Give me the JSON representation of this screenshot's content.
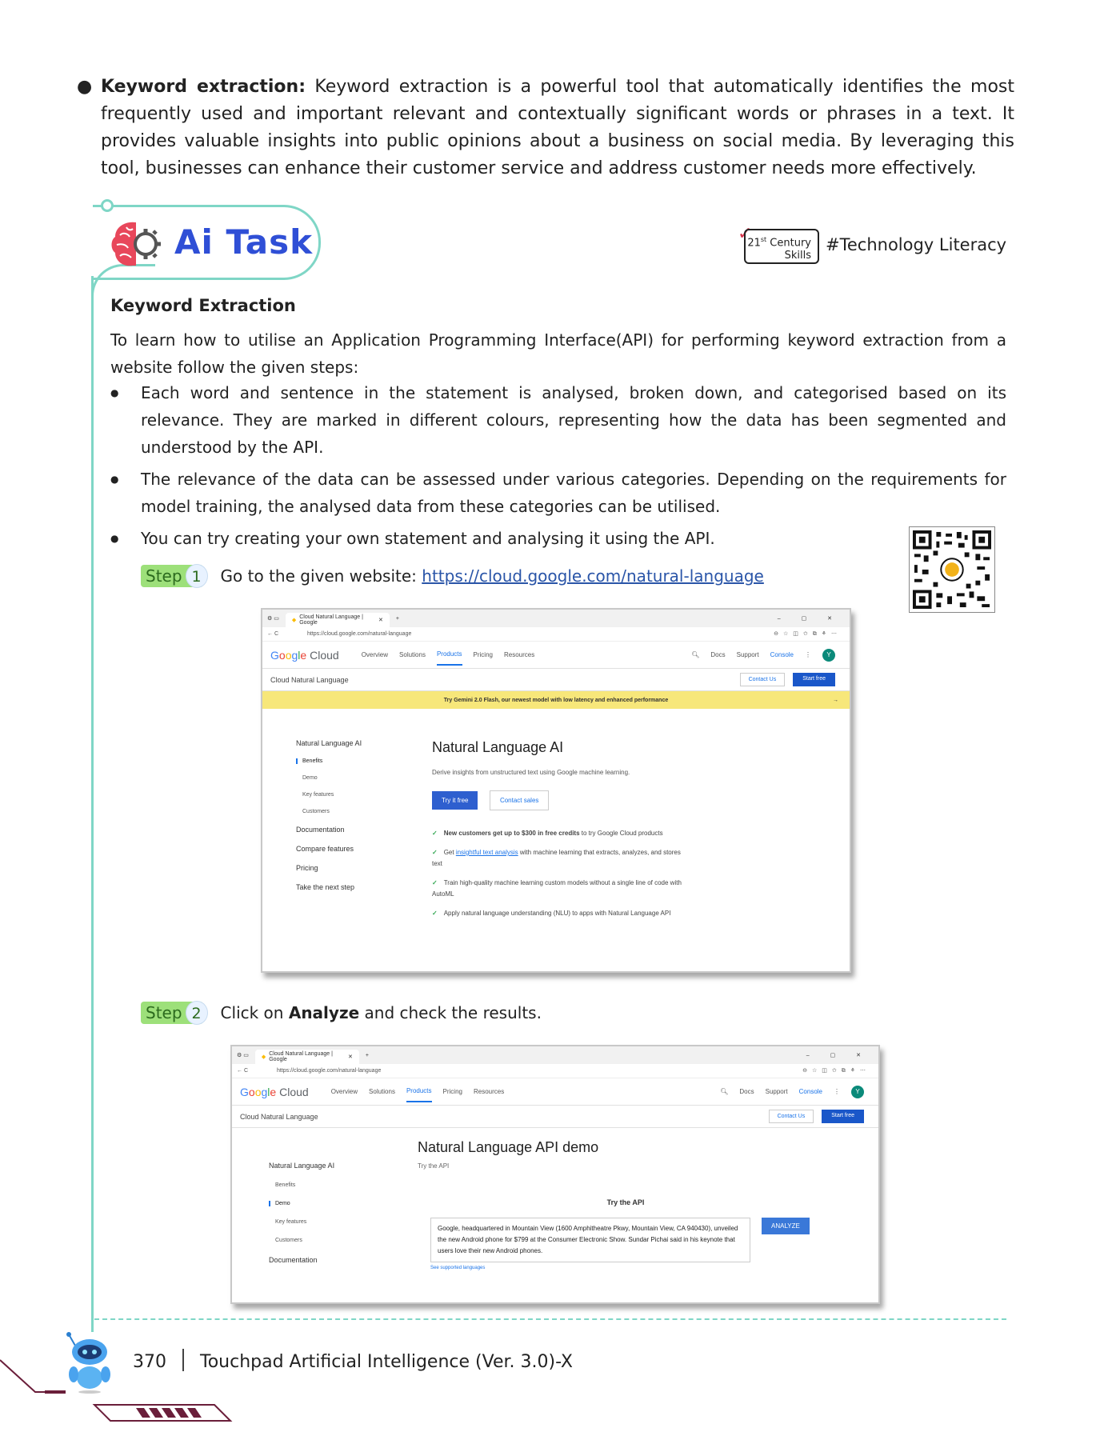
{
  "intro": {
    "term": "Keyword extraction:",
    "text": " Keyword extraction is a powerful tool that automatically identifies the most frequently used and important relevant and contextually significant words or phrases in a text. It provides valuable insights into public opinions about a business on social media. By leveraging this tool, businesses can enhance their customer service and address customer needs more effectively."
  },
  "task": {
    "title": "Ai Task",
    "badge_line1": "21",
    "badge_sup": "st",
    "badge_line1_rest": " Century",
    "badge_line2": "Skills",
    "hashtag": "#Technology Literacy"
  },
  "section": {
    "title": "Keyword Extraction",
    "body": "To learn how to utilise an Application Programming Interface(API) for performing keyword extraction from a website follow the given steps:",
    "bullets": [
      "Each word and sentence in the statement is analysed, broken down, and categorised based on its relevance. They are marked in different colours, representing how the data has been segmented and understood by the API.",
      "The relevance of the data can be assessed under various categories. Depending on the requirements for model training, the analysed data from these categories can be utilised.",
      "You can try creating your own statement and analysing it using the API."
    ]
  },
  "step1": {
    "label": "Step",
    "num": "1",
    "text": "Go to the given website: ",
    "link": "https://cloud.google.com/natural-language"
  },
  "step2": {
    "label": "Step",
    "num": "2",
    "text_a": "Click on ",
    "text_bold": "Analyze",
    "text_b": " and check the results."
  },
  "browser1": {
    "tab": "Cloud Natural Language | Google",
    "url": "https://cloud.google.com/natural-language",
    "nav": [
      "Overview",
      "Solutions",
      "Products",
      "Pricing",
      "Resources"
    ],
    "right_nav": [
      "Docs",
      "Support",
      "Console"
    ],
    "avatar": "Y",
    "subbar_title": "Cloud Natural Language",
    "contact": "Contact Us",
    "start": "Start free",
    "banner": "Try Gemini 2.0 Flash, our newest model with low latency and enhanced performance",
    "side_title": "Natural Language AI",
    "side_sub": [
      "Benefits",
      "Demo",
      "Key features",
      "Customers"
    ],
    "side_links": [
      "Documentation",
      "Compare features",
      "Pricing",
      "Take the next step"
    ],
    "heading": "Natural Language AI",
    "desc": "Derive insights from unstructured text using Google machine learning.",
    "btn_try": "Try it free",
    "btn_contact": "Contact sales",
    "checks": [
      {
        "bold": "New customers get up to $300 in free credits",
        "rest": " to try Google Cloud products"
      },
      {
        "bold": "",
        "pre": "Get ",
        "link": "insightful text analysis",
        "rest": " with machine learning that extracts, analyzes, and stores text"
      },
      {
        "bold": "",
        "rest": "Train high-quality machine learning custom models without a single line of code with AutoML"
      },
      {
        "bold": "",
        "rest": "Apply natural language understanding (NLU) to apps with Natural Language API"
      }
    ]
  },
  "browser2": {
    "tab": "Cloud Natural Language | Google",
    "url": "https://cloud.google.com/natural-language",
    "subbar_title": "Cloud Natural Language",
    "side_title": "Natural Language AI",
    "side_sub": [
      "Benefits",
      "Demo",
      "Key features",
      "Customers"
    ],
    "side_link": "Documentation",
    "heading": "Natural Language API demo",
    "sub": "Try the API",
    "try_api": "Try the API",
    "sample": "Google, headquartered in Mountain View (1600 Amphitheatre Pkwy, Mountain View, CA 940430), unveiled the new Android phone for $799 at the Consumer Electronic Show. Sundar Pichai said in his keynote that users love their new Android phones.",
    "analyze": "ANALYZE",
    "see_langs": "See supported languages"
  },
  "footer": {
    "page": "370",
    "book": "Touchpad Artificial Intelligence (Ver. 3.0)-X"
  },
  "colors": {
    "accent": "#7fd6c6",
    "task_blue": "#2f4fd6",
    "step_green": "#9de07a"
  }
}
